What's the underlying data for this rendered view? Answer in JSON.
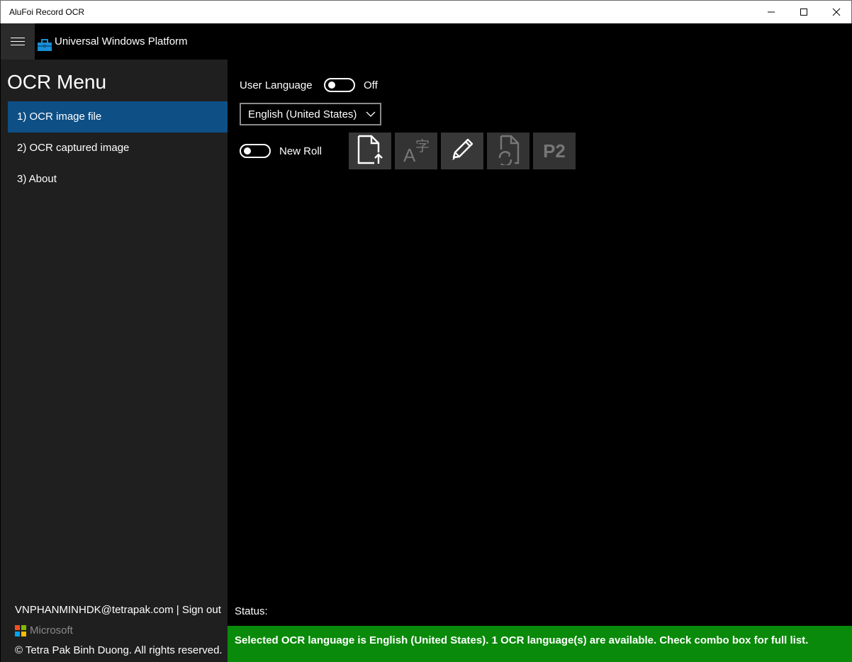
{
  "window": {
    "title": "AluFoi Record OCR"
  },
  "header": {
    "app_title": "Universal Windows Platform"
  },
  "sidebar": {
    "title": "OCR Menu",
    "items": [
      {
        "label": "1) OCR image file",
        "selected": true
      },
      {
        "label": "2) OCR captured image",
        "selected": false
      },
      {
        "label": "3) About",
        "selected": false
      }
    ],
    "user": "VNPHANMINHDK@tetrapak.com",
    "signout": "Sign out",
    "separator": " | ",
    "microsoft": "Microsoft",
    "copyright": "© Tetra Pak Binh Duong. All rights reserved."
  },
  "main": {
    "user_language_label": "User Language",
    "user_language_state": "Off",
    "language_value": "English (United States)",
    "new_roll_label": "New Roll",
    "toolbar": {
      "p2_label": "P2"
    },
    "status_label": "Status:",
    "status_message": "Selected OCR language is English (United States). 1 OCR language(s) are available. Check combo box for full list."
  },
  "colors": {
    "accent": "#0e4f86",
    "status_green": "#0a8a0a",
    "sidebar_bg": "#1f1f1f"
  }
}
